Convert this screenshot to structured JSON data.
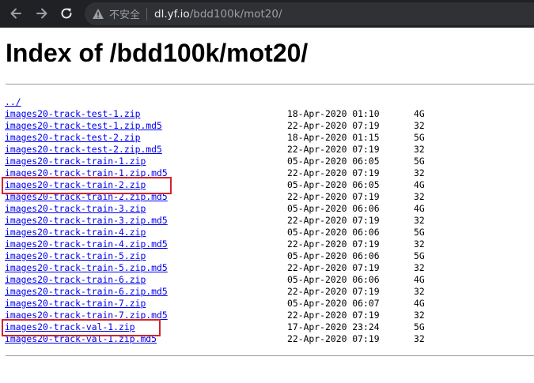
{
  "browser": {
    "security_label": "不安全",
    "url_host": "dl.yf.io",
    "url_path": "/bdd100k/mot20/"
  },
  "page": {
    "title": "Index of /bdd100k/mot20/",
    "parent_link": "../",
    "files": [
      {
        "name": "images20-track-test-1.zip",
        "date": "18-Apr-2020 01:10",
        "size": "4G"
      },
      {
        "name": "images20-track-test-1.zip.md5",
        "date": "22-Apr-2020 07:19",
        "size": "32"
      },
      {
        "name": "images20-track-test-2.zip",
        "date": "18-Apr-2020 01:15",
        "size": "5G"
      },
      {
        "name": "images20-track-test-2.zip.md5",
        "date": "22-Apr-2020 07:19",
        "size": "32"
      },
      {
        "name": "images20-track-train-1.zip",
        "date": "05-Apr-2020 06:05",
        "size": "5G"
      },
      {
        "name": "images20-track-train-1.zip.md5",
        "date": "22-Apr-2020 07:19",
        "size": "32"
      },
      {
        "name": "images20-track-train-2.zip",
        "date": "05-Apr-2020 06:05",
        "size": "4G"
      },
      {
        "name": "images20-track-train-2.zip.md5",
        "date": "22-Apr-2020 07:19",
        "size": "32"
      },
      {
        "name": "images20-track-train-3.zip",
        "date": "05-Apr-2020 06:06",
        "size": "4G"
      },
      {
        "name": "images20-track-train-3.zip.md5",
        "date": "22-Apr-2020 07:19",
        "size": "32"
      },
      {
        "name": "images20-track-train-4.zip",
        "date": "05-Apr-2020 06:06",
        "size": "5G"
      },
      {
        "name": "images20-track-train-4.zip.md5",
        "date": "22-Apr-2020 07:19",
        "size": "32"
      },
      {
        "name": "images20-track-train-5.zip",
        "date": "05-Apr-2020 06:06",
        "size": "5G"
      },
      {
        "name": "images20-track-train-5.zip.md5",
        "date": "22-Apr-2020 07:19",
        "size": "32"
      },
      {
        "name": "images20-track-train-6.zip",
        "date": "05-Apr-2020 06:06",
        "size": "4G"
      },
      {
        "name": "images20-track-train-6.zip.md5",
        "date": "22-Apr-2020 07:19",
        "size": "32"
      },
      {
        "name": "images20-track-train-7.zip",
        "date": "05-Apr-2020 06:07",
        "size": "4G"
      },
      {
        "name": "images20-track-train-7.zip.md5",
        "date": "22-Apr-2020 07:19",
        "size": "32"
      },
      {
        "name": "images20-track-val-1.zip",
        "date": "17-Apr-2020 23:24",
        "size": "5G"
      },
      {
        "name": "images20-track-val-1.zip.md5",
        "date": "22-Apr-2020 07:19",
        "size": "32"
      }
    ]
  },
  "highlighted_files": [
    "images20-track-train-2.zip",
    "images20-track-val-1.zip"
  ],
  "colors": {
    "toolbar_bg": "#202124",
    "omnibox_bg": "#303134",
    "link": "#0000ee",
    "highlight": "#d3232a"
  },
  "icons": {
    "back": "arrow-left-icon",
    "forward": "arrow-right-icon",
    "reload": "reload-icon",
    "security": "warning-triangle-icon"
  }
}
